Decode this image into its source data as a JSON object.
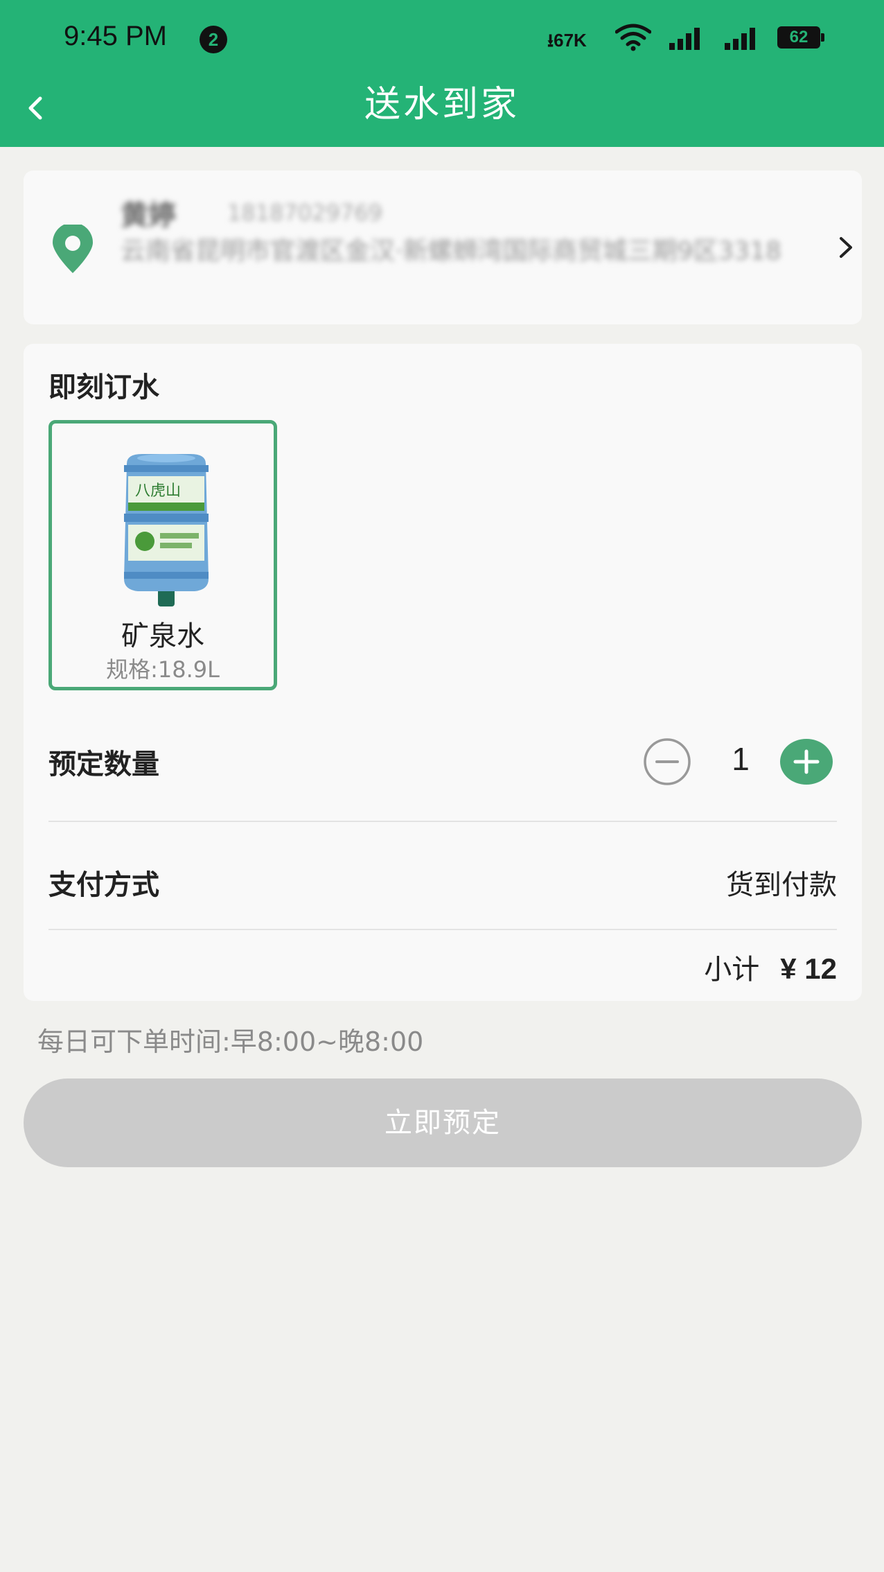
{
  "status_bar": {
    "time": "9:45 PM",
    "notification_count": "2",
    "net_speed": "67K",
    "battery": "62"
  },
  "header": {
    "title": "送水到家"
  },
  "address": {
    "name": "黄婷",
    "phone": "18187029769",
    "line": "云南省昆明市官渡区金汉·新螺蛳湾国际商贸城三期9区3318"
  },
  "order": {
    "section_title": "即刻订水",
    "product": {
      "name": "矿泉水",
      "spec": "规格:18.9L",
      "selected": true
    },
    "quantity_label": "预定数量",
    "quantity": "1",
    "payment_label": "支付方式",
    "payment_value": "货到付款",
    "subtotal_label": "小计",
    "subtotal_amount": "¥ 12"
  },
  "order_hours": "每日可下单时间:早8:00~晚8:00",
  "submit_label": "立即预定",
  "colors": {
    "brand_green": "#24b376",
    "tile_border": "#4aa877",
    "disabled_button": "#cbcbcb"
  }
}
